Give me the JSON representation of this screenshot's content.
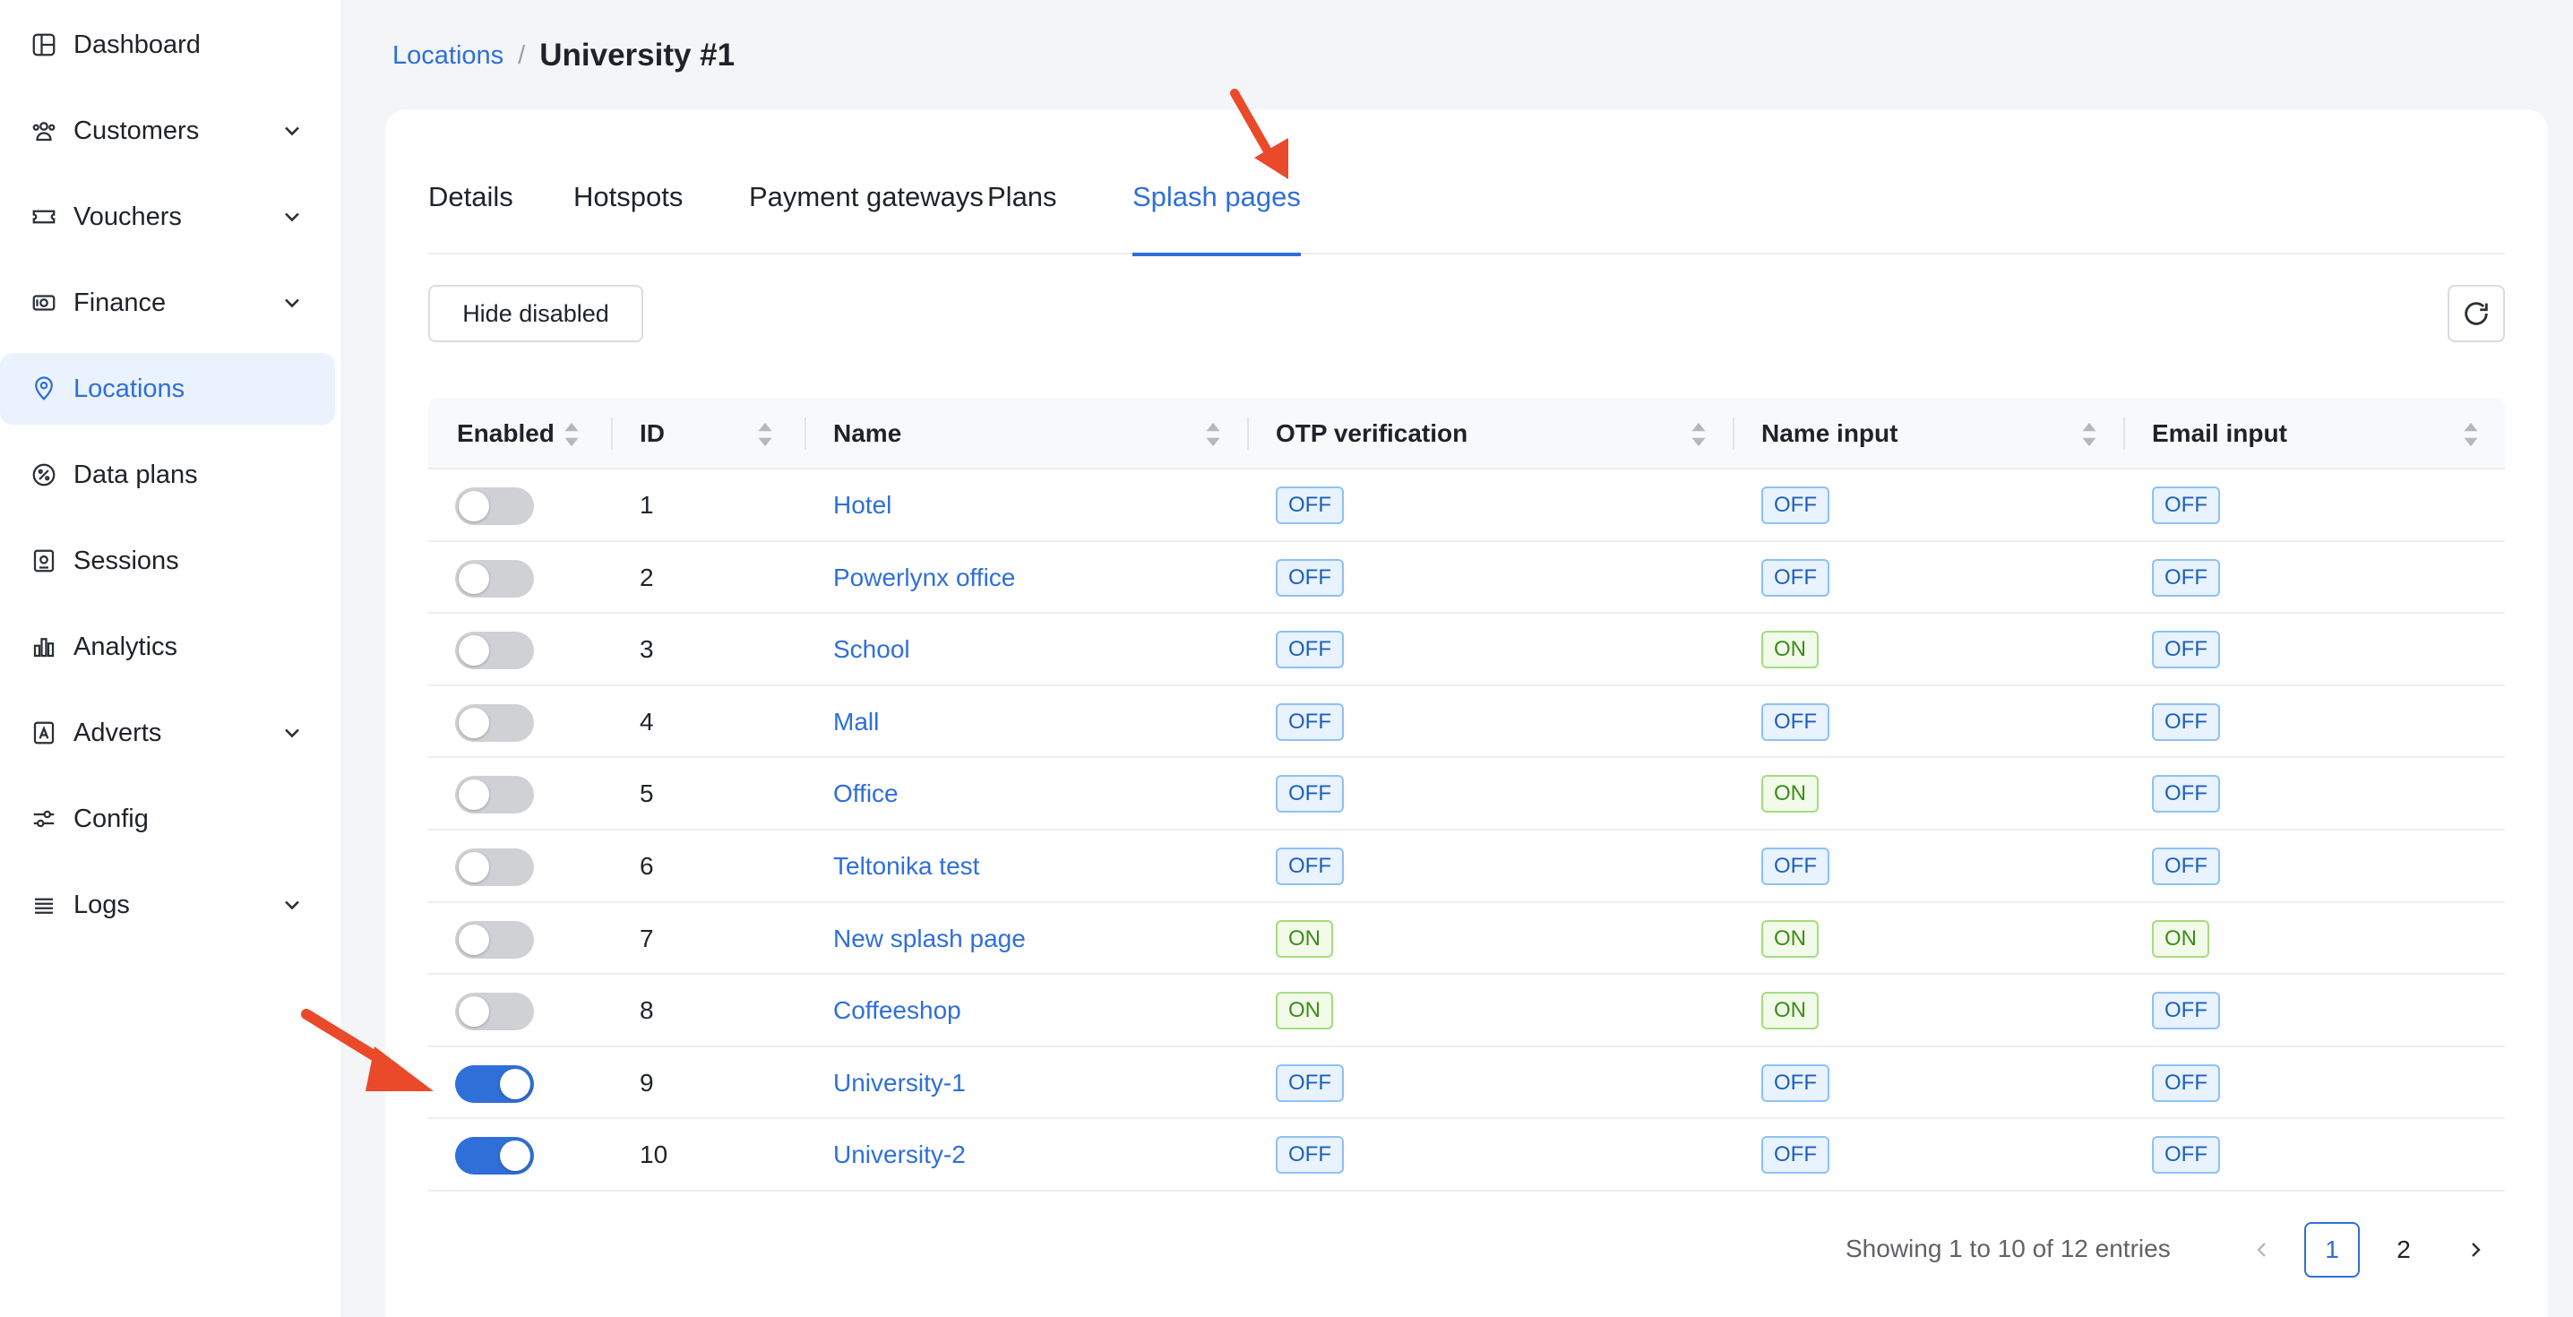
{
  "sidebar": {
    "items": [
      {
        "label": "Dashboard",
        "icon": "dashboard-icon",
        "has_chevron": false,
        "active": false
      },
      {
        "label": "Customers",
        "icon": "users-icon",
        "has_chevron": true,
        "active": false
      },
      {
        "label": "Vouchers",
        "icon": "ticket-icon",
        "has_chevron": true,
        "active": false
      },
      {
        "label": "Finance",
        "icon": "money-icon",
        "has_chevron": true,
        "active": false
      },
      {
        "label": "Locations",
        "icon": "location-pin-icon",
        "has_chevron": false,
        "active": true
      },
      {
        "label": "Data plans",
        "icon": "pie-chart-icon",
        "has_chevron": false,
        "active": false
      },
      {
        "label": "Sessions",
        "icon": "sessions-icon",
        "has_chevron": false,
        "active": false
      },
      {
        "label": "Analytics",
        "icon": "bar-chart-icon",
        "has_chevron": false,
        "active": false
      },
      {
        "label": "Adverts",
        "icon": "advert-icon",
        "has_chevron": true,
        "active": false
      },
      {
        "label": "Config",
        "icon": "sliders-icon",
        "has_chevron": false,
        "active": false
      },
      {
        "label": "Logs",
        "icon": "list-icon",
        "has_chevron": true,
        "active": false
      }
    ]
  },
  "breadcrumb": {
    "parent": "Locations",
    "separator": "/",
    "current": "University #1"
  },
  "tabs": [
    {
      "label": "Details",
      "active": false
    },
    {
      "label": "Hotspots",
      "active": false
    },
    {
      "label": "Payment gateways",
      "active": false
    },
    {
      "label": "Plans",
      "active": false
    },
    {
      "label": "Splash pages",
      "active": true
    }
  ],
  "toolbar": {
    "hide_disabled_label": "Hide disabled",
    "refresh_icon": "refresh-icon"
  },
  "table": {
    "columns": [
      "Enabled",
      "ID",
      "Name",
      "OTP verification",
      "Name input",
      "Email input"
    ],
    "rows": [
      {
        "enabled": false,
        "id": "1",
        "name": "Hotel",
        "otp": "OFF",
        "name_input": "OFF",
        "email_input": "OFF"
      },
      {
        "enabled": false,
        "id": "2",
        "name": "Powerlynx office",
        "otp": "OFF",
        "name_input": "OFF",
        "email_input": "OFF"
      },
      {
        "enabled": false,
        "id": "3",
        "name": "School",
        "otp": "OFF",
        "name_input": "ON",
        "email_input": "OFF"
      },
      {
        "enabled": false,
        "id": "4",
        "name": "Mall",
        "otp": "OFF",
        "name_input": "OFF",
        "email_input": "OFF"
      },
      {
        "enabled": false,
        "id": "5",
        "name": "Office",
        "otp": "OFF",
        "name_input": "ON",
        "email_input": "OFF"
      },
      {
        "enabled": false,
        "id": "6",
        "name": "Teltonika test",
        "otp": "OFF",
        "name_input": "OFF",
        "email_input": "OFF"
      },
      {
        "enabled": false,
        "id": "7",
        "name": "New splash page",
        "otp": "ON",
        "name_input": "ON",
        "email_input": "ON"
      },
      {
        "enabled": false,
        "id": "8",
        "name": "Coffeeshop",
        "otp": "ON",
        "name_input": "ON",
        "email_input": "OFF"
      },
      {
        "enabled": true,
        "id": "9",
        "name": "University-1",
        "otp": "OFF",
        "name_input": "OFF",
        "email_input": "OFF"
      },
      {
        "enabled": true,
        "id": "10",
        "name": "University-2",
        "otp": "OFF",
        "name_input": "OFF",
        "email_input": "OFF"
      }
    ]
  },
  "pagination": {
    "info": "Showing 1 to 10 of 12 entries",
    "pages": [
      "1",
      "2"
    ],
    "current_page": "1"
  },
  "colors": {
    "accent": "#2f6fd8",
    "annotation_arrow": "#ea4a2a"
  }
}
